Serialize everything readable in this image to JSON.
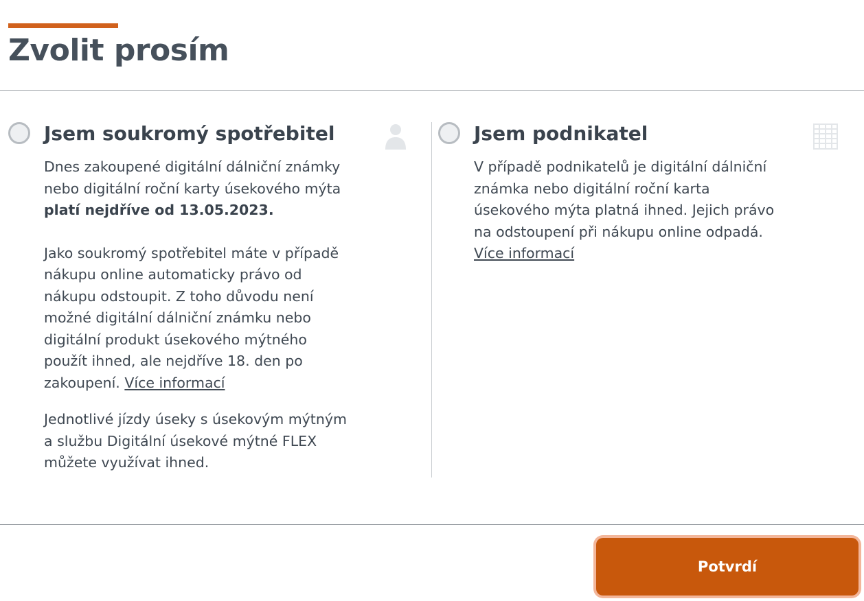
{
  "header": {
    "title": "Zvolit prosím",
    "accent_color": "#d1611c"
  },
  "options": {
    "private": {
      "title": "Jsem soukromý spotřebitel",
      "icon": "person-icon",
      "para1_text": "Dnes zakoupené digitální dálniční známky nebo digitální roční karty úsekového mýta ",
      "para1_bold": "platí nejdříve od 13.05.2023.",
      "para2_text": "Jako soukromý spotřebitel máte v případě nákupu online automaticky právo od nákupu odstoupit. Z toho důvodu není možné digitální dálniční známku nebo digitální produkt úsekového mýtného použít ihned, ale nejdříve 18. den po zakoupení. ",
      "para2_link": "Více informací",
      "para3_text": "Jednotlivé jízdy úseky s úsekovým mýtným a službu Digitální úsekové mýtné FLEX můžete využívat ihned.",
      "selected": false
    },
    "business": {
      "title": "Jsem podnikatel",
      "icon": "building-icon",
      "para1_text": "V případě podnikatelů je digitální dálniční známka nebo digitální roční karta úsekového mýta platná ihned. Jejich právo na odstoupení při nákupu online odpadá.",
      "para1_link": "Více informací",
      "selected": false
    }
  },
  "footer": {
    "confirm_label": "Potvrdí",
    "button_color": "#c8580c"
  }
}
